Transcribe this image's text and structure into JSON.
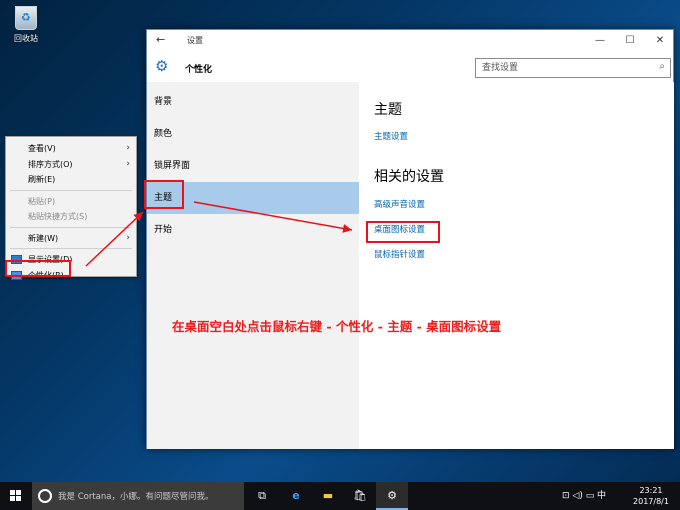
{
  "desktop": {
    "recycle_bin_label": "回收站"
  },
  "context_menu": {
    "items": [
      {
        "label": "查看(V)",
        "submenu": true,
        "disabled": false
      },
      {
        "label": "排序方式(O)",
        "submenu": true,
        "disabled": false
      },
      {
        "label": "刷新(E)",
        "submenu": false,
        "disabled": false
      },
      {
        "label": "粘贴(P)",
        "submenu": false,
        "disabled": true
      },
      {
        "label": "粘贴快捷方式(S)",
        "submenu": false,
        "disabled": true
      },
      {
        "label": "新建(W)",
        "submenu": true,
        "disabled": false
      },
      {
        "label": "显示设置(D)",
        "submenu": false,
        "disabled": false
      },
      {
        "label": "个性化(R)",
        "submenu": false,
        "disabled": false
      }
    ]
  },
  "window": {
    "title": "设置",
    "back_glyph": "←",
    "controls": {
      "minimize": "—",
      "maximize": "☐",
      "close": "✕"
    },
    "page_title": "个性化",
    "search": {
      "placeholder": "查找设置"
    }
  },
  "nav": {
    "items": [
      {
        "label": "背景",
        "active": false
      },
      {
        "label": "颜色",
        "active": false
      },
      {
        "label": "锁屏界面",
        "active": false
      },
      {
        "label": "主题",
        "active": true
      },
      {
        "label": "开始",
        "active": false
      }
    ]
  },
  "content": {
    "theme_heading": "主题",
    "theme_settings_link": "主题设置",
    "related_heading": "相关的设置",
    "related_links": [
      "高级声音设置",
      "桌面图标设置",
      "鼠标指针设置"
    ]
  },
  "annotation": {
    "text": "在桌面空白处点击鼠标右键 - 个性化 - 主题 - 桌面图标设置",
    "color": "#f01b1b"
  },
  "taskbar": {
    "cortana_placeholder": "我是 Cortana，小娜。有问题尽管问我。",
    "tray_text": "⊡ ◁) ▭ 中",
    "clock": {
      "time": "23:21",
      "date": "2017/8/1"
    }
  },
  "colors": {
    "accent": "#0063b1",
    "nav_active": "#a9cbeb",
    "highlight_box": "#e8131b"
  }
}
